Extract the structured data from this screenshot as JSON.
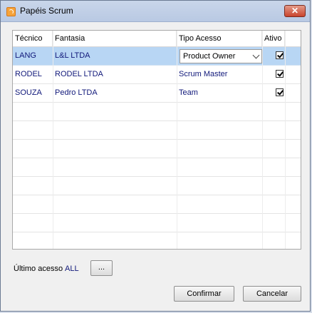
{
  "window": {
    "title": "Papéis Scrum",
    "close_glyph": "✕"
  },
  "grid": {
    "columns": [
      "Técnico",
      "Fantasia",
      "Tipo Acesso",
      "Ativo"
    ],
    "rows": [
      {
        "tecnico": "LANG",
        "fantasia": "L&L LTDA",
        "tipo": "Product Owner",
        "ativo": true,
        "selected": true
      },
      {
        "tecnico": "RODEL",
        "fantasia": "RODEL LTDA",
        "tipo": "Scrum Master",
        "ativo": true,
        "selected": false
      },
      {
        "tecnico": "SOUZA",
        "fantasia": "Pedro LTDA",
        "tipo": "Team",
        "ativo": true,
        "selected": false
      }
    ]
  },
  "footer": {
    "last_access_label": "Último acesso",
    "last_access_value": "ALL",
    "browse_label": "...",
    "confirm_label": "Confirmar",
    "cancel_label": "Cancelar"
  },
  "colors": {
    "selected_row": "#b8d6f4",
    "data_text": "#10187a"
  }
}
